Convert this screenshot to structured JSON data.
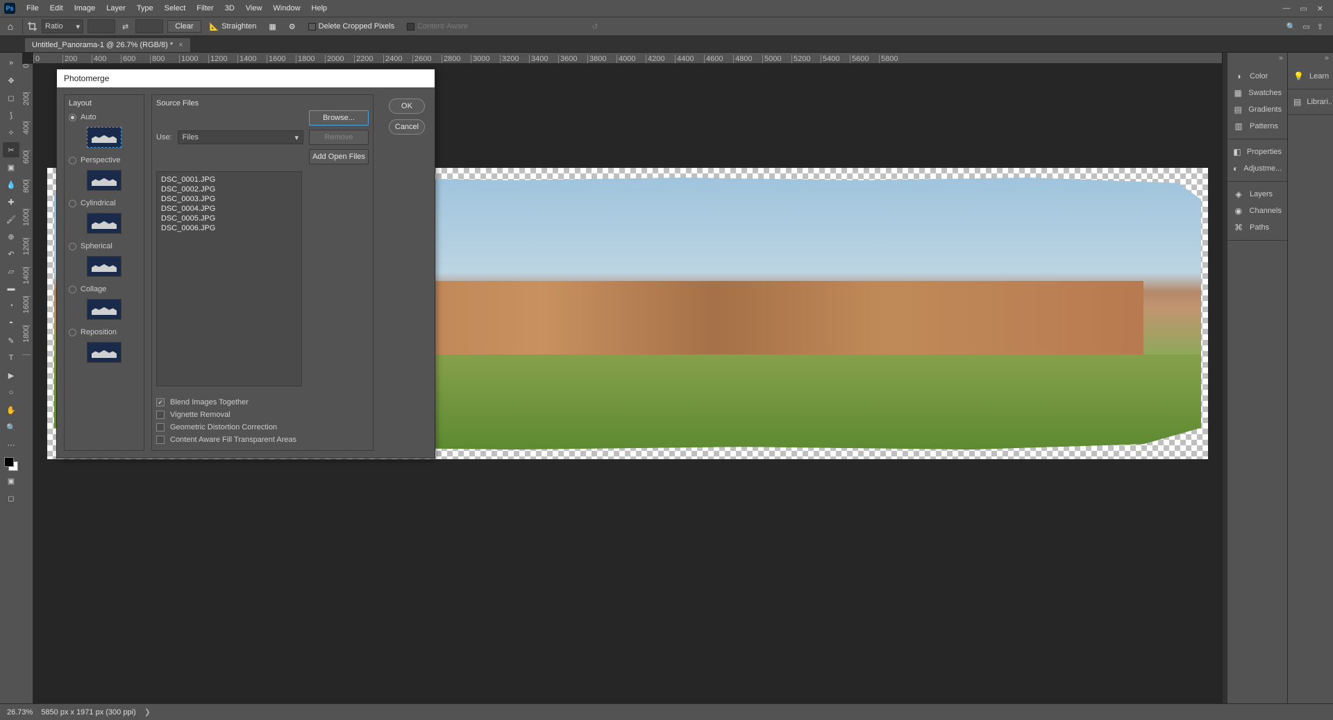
{
  "menu": {
    "items": [
      "File",
      "Edit",
      "Image",
      "Layer",
      "Type",
      "Select",
      "Filter",
      "3D",
      "View",
      "Window",
      "Help"
    ]
  },
  "options_bar": {
    "ratio_label": "Ratio",
    "w": "",
    "h": "",
    "clear": "Clear",
    "straighten": "Straighten",
    "delete_cropped": "Delete Cropped Pixels",
    "content_aware": "Content-Aware"
  },
  "doc_tab": {
    "title": "Untitled_Panorama-1 @ 26.7% (RGB/8) *"
  },
  "ruler_ticks": [
    "0",
    "200",
    "400",
    "600",
    "800",
    "1000",
    "1200",
    "1400",
    "1600",
    "1800",
    "2000",
    "2200",
    "2400",
    "2600",
    "2800",
    "3000",
    "3200",
    "3400",
    "3600",
    "3800",
    "4000",
    "4200",
    "4400",
    "4600",
    "4800",
    "5000",
    "5200",
    "5400",
    "5600",
    "5800"
  ],
  "ruler_v": [
    "0",
    "200",
    "400",
    "600",
    "800",
    "1000",
    "1200",
    "1400",
    "1600",
    "1800"
  ],
  "right_panels": {
    "g1": [
      {
        "icon": "◑",
        "label": "Color"
      },
      {
        "icon": "▦",
        "label": "Swatches"
      },
      {
        "icon": "▤",
        "label": "Gradients"
      },
      {
        "icon": "▥",
        "label": "Patterns"
      }
    ],
    "g2": [
      {
        "icon": "◧",
        "label": "Properties"
      },
      {
        "icon": "◐",
        "label": "Adjustme..."
      }
    ],
    "g3": [
      {
        "icon": "◈",
        "label": "Layers"
      },
      {
        "icon": "◉",
        "label": "Channels"
      },
      {
        "icon": "⌘",
        "label": "Paths"
      }
    ]
  },
  "right2": {
    "learn": "Learn",
    "libraries": "Librari..."
  },
  "status": {
    "zoom": "26.73%",
    "doc": "5850 px x 1971 px (300 ppi)"
  },
  "dialog": {
    "title": "Photomerge",
    "layout_label": "Layout",
    "layouts": [
      {
        "key": "auto",
        "label": "Auto",
        "sel": true
      },
      {
        "key": "perspective",
        "label": "Perspective",
        "sel": false
      },
      {
        "key": "cylindrical",
        "label": "Cylindrical",
        "sel": false
      },
      {
        "key": "spherical",
        "label": "Spherical",
        "sel": false
      },
      {
        "key": "collage",
        "label": "Collage",
        "sel": false
      },
      {
        "key": "reposition",
        "label": "Reposition",
        "sel": false
      }
    ],
    "source_label": "Source Files",
    "use_label": "Use:",
    "use_value": "Files",
    "files": [
      "DSC_0001.JPG",
      "DSC_0002.JPG",
      "DSC_0003.JPG",
      "DSC_0004.JPG",
      "DSC_0005.JPG",
      "DSC_0006.JPG"
    ],
    "browse": "Browse...",
    "remove": "Remove",
    "add_open": "Add Open Files",
    "ok": "OK",
    "cancel": "Cancel",
    "checks": [
      {
        "label": "Blend Images Together",
        "on": true
      },
      {
        "label": "Vignette Removal",
        "on": false
      },
      {
        "label": "Geometric Distortion Correction",
        "on": false
      },
      {
        "label": "Content Aware Fill Transparent Areas",
        "on": false
      }
    ]
  }
}
